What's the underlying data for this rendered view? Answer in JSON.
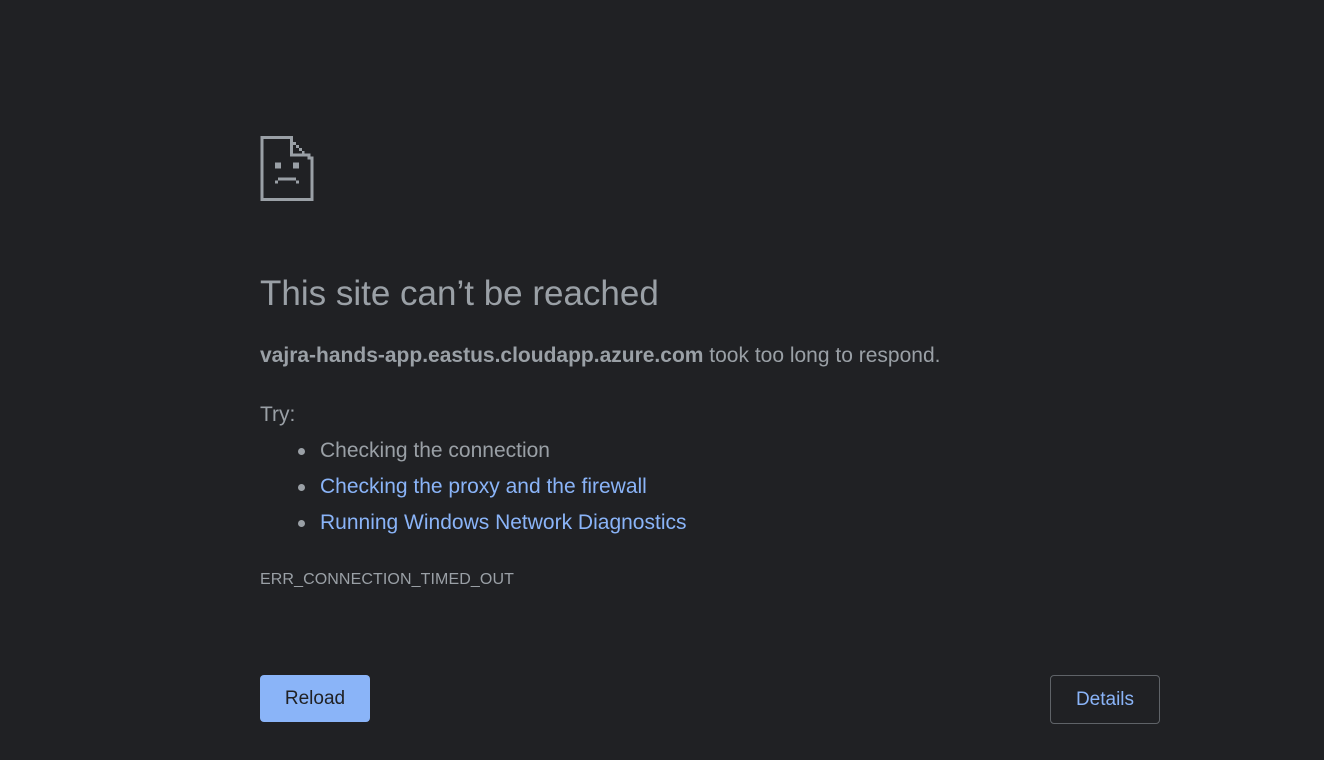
{
  "page": {
    "background": "#202124",
    "text_color": "#9aa0a6",
    "link_color": "#8ab4f8",
    "icon": "sad-page-icon"
  },
  "error": {
    "title": "This site can’t be reached",
    "host": "vajra-hands-app.eastus.cloudapp.azure.com",
    "message": " took too long to respond.",
    "try_label": "Try:",
    "suggestions": [
      {
        "label": "Checking the connection",
        "link": false
      },
      {
        "label": "Checking the proxy and the firewall",
        "link": true
      },
      {
        "label": "Running Windows Network Diagnostics",
        "link": true
      }
    ],
    "code": "ERR_CONNECTION_TIMED_OUT"
  },
  "buttons": {
    "reload_label": "Reload",
    "details_label": "Details"
  }
}
